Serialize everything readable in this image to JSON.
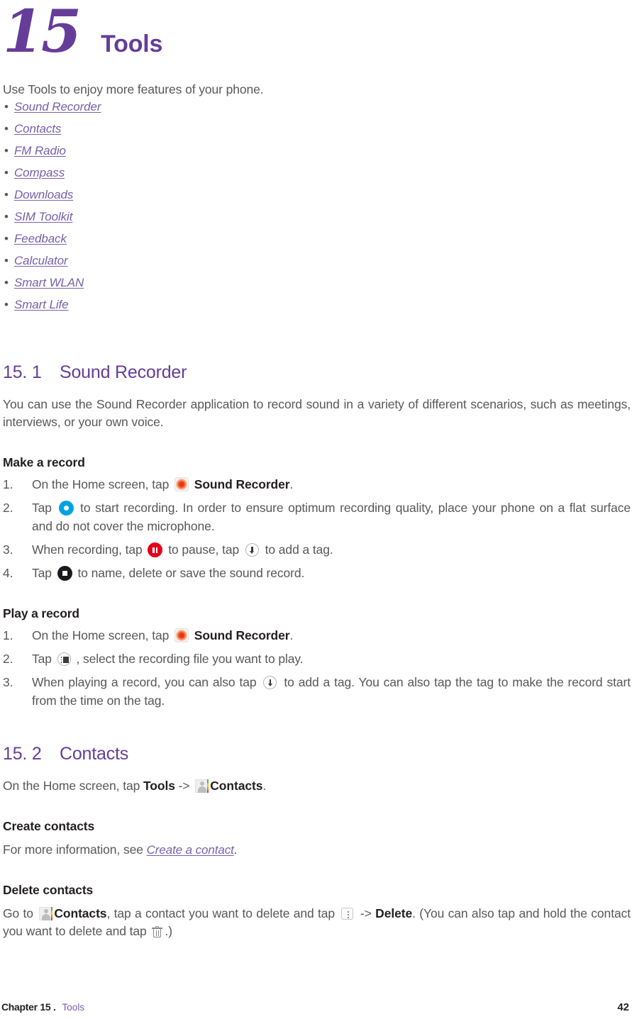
{
  "chapter": {
    "number": "15",
    "title": "Tools"
  },
  "intro": {
    "text": "Use Tools to enjoy more features of your phone.",
    "links": [
      "Sound Recorder",
      "Contacts",
      "FM Radio ",
      "Compass",
      "Downloads",
      "SIM Toolkit",
      "Feedback",
      "Calculator",
      "Smart WLAN",
      "Smart Life"
    ]
  },
  "section_1": {
    "number": "15. 1",
    "title": "Sound Recorder",
    "intro": "You can use the Sound Recorder application to record sound in a variety of different scenarios, such as meetings, interviews, or your own voice.",
    "make_a_record": {
      "heading": "Make a record",
      "steps": [
        {
          "index": "1.",
          "before": "On the Home screen, tap",
          "icon": "sound-recorder-app-icon",
          "bold": "Sound Recorder",
          "after": "."
        },
        {
          "index": "2.",
          "before": "Tap",
          "icon": "record-button-icon",
          "after": "to start recording. In order to ensure optimum recording quality, place your phone on a flat surface and do not cover the microphone."
        },
        {
          "index": "3.",
          "before": "When recording, tap",
          "icon": "pause-button-icon",
          "middle": "to pause, tap",
          "icon2": "add-tag-icon",
          "after": "to add a tag."
        },
        {
          "index": "4.",
          "before": "Tap",
          "icon": "stop-button-icon",
          "after": "to name, delete or save the sound record."
        }
      ]
    },
    "play_a_record": {
      "heading": "Play a record",
      "steps": [
        {
          "index": "1.",
          "before": "On the Home screen, tap",
          "icon": "sound-recorder-app-icon",
          "bold": "Sound Recorder",
          "after": "."
        },
        {
          "index": "2.",
          "before": "Tap",
          "icon": "recording-list-icon",
          "after": ", select the recording file you want to play."
        },
        {
          "index": "3.",
          "before": "When playing a record, you can also tap",
          "icon": "add-tag-icon",
          "after": "to add a tag. You can also tap the tag to make the record start from the time on the tag."
        }
      ]
    }
  },
  "section_2": {
    "number": "15. 2",
    "title": "Contacts",
    "intro": {
      "before": "On the Home screen, tap",
      "bold1": "Tools",
      "arrow": "->",
      "icon": "contacts-app-icon",
      "bold2": "Contacts",
      "after": "."
    },
    "create_contacts": {
      "heading": "Create contacts",
      "before": "For more information, see",
      "link": "Create a contact",
      "after": "."
    },
    "delete_contacts": {
      "heading": "Delete contacts",
      "p1_before": "Go to",
      "p1_icon": "contacts-app-icon",
      "p1_bold1": "Contacts",
      "p1_mid": ", tap a contact you want to delete and tap",
      "p1_icon2": "overflow-menu-icon",
      "p1_arrow": "->",
      "p1_bold2": "Delete",
      "p1_mid2": ". (You can also tap and hold the contact you want to delete and tap",
      "p1_icon3": "trash-icon",
      "p1_after": ".)"
    }
  },
  "footer": {
    "chapter": "Chapter 15 .",
    "chapter_name": "Tools",
    "page_number": "42"
  },
  "colors": {
    "heading_purple": "#653d99",
    "link_purple": "#7761ab",
    "body_gray": "#58585a",
    "bold_black": "#231f20",
    "record_blue": "#00a3e0",
    "pause_red": "#e2001a",
    "stop_black": "#1a1a1e"
  }
}
